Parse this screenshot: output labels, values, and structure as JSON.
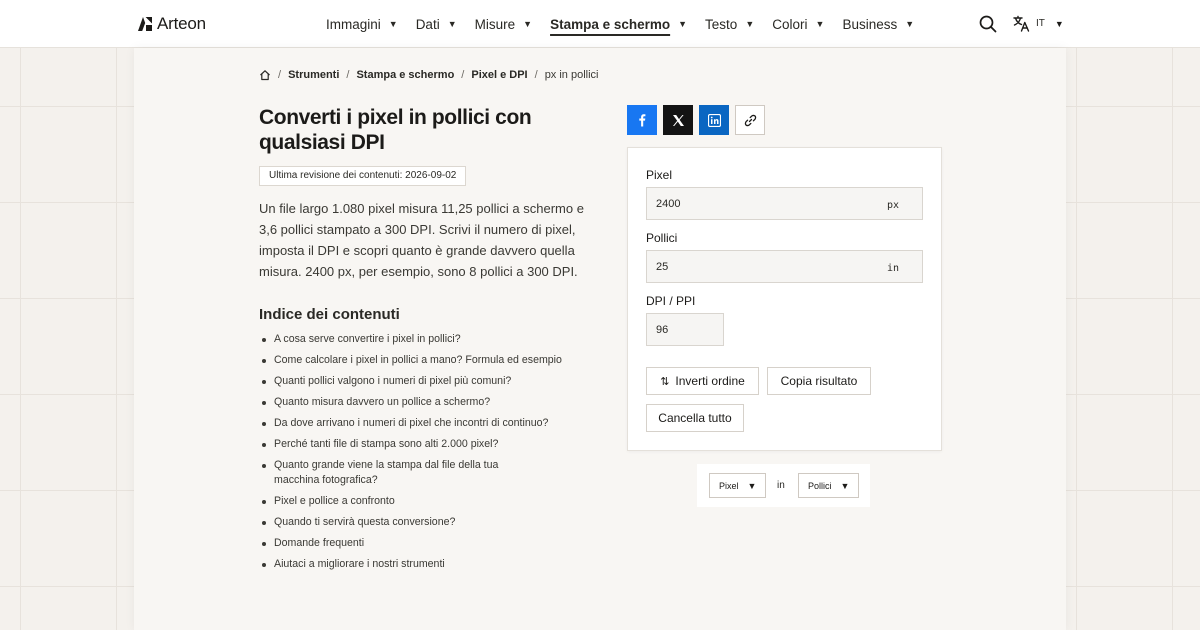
{
  "brand": {
    "name": "Arteon"
  },
  "nav": {
    "items": [
      {
        "label": "Immagini",
        "active": false
      },
      {
        "label": "Dati",
        "active": false
      },
      {
        "label": "Misure",
        "active": false
      },
      {
        "label": "Stampa e schermo",
        "active": true
      },
      {
        "label": "Testo",
        "active": false
      },
      {
        "label": "Colori",
        "active": false
      },
      {
        "label": "Business",
        "active": false
      }
    ],
    "caret": "▼",
    "language": "IT"
  },
  "breadcrumb": {
    "items": [
      "Strumenti",
      "Stampa e schermo",
      "Pixel e DPI"
    ],
    "current": "px in pollici",
    "separator": "/"
  },
  "page": {
    "title": "Converti i pixel in pollici con qualsiasi DPI",
    "revision": "Ultima revisione dei contenuti: 2026-09-02",
    "intro": "Un file largo 1.080 pixel misura 11,25 pollici a schermo e 3,6 pollici stampato a 300 DPI. Scrivi il numero di pixel, imposta il DPI e scopri quanto è grande davvero quella misura. 2400 px, per esempio, sono 8 pollici a 300 DPI."
  },
  "toc": {
    "title": "Indice dei contenuti",
    "items": [
      "A cosa serve convertire i pixel in pollici?",
      "Come calcolare i pixel in pollici a mano? Formula ed esempio",
      "Quanti pollici valgono i numeri di pixel più comuni?",
      "Quanto misura davvero un pollice a schermo?",
      "Da dove arrivano i numeri di pixel che incontri di continuo?",
      "Perché tanti file di stampa sono alti 2.000 pixel?",
      "Quanto grande viene la stampa dal file della tua macchina fotografica?",
      "Pixel e pollice a confronto",
      "Quando ti servirà questa conversione?",
      "Domande frequenti",
      "Aiutaci a migliorare i nostri strumenti"
    ]
  },
  "share": {
    "icons": [
      "facebook-icon",
      "x-icon",
      "linkedin-icon",
      "link-icon"
    ],
    "colors": {
      "facebook": "#1877f2",
      "x": "#141414",
      "linkedin": "#0a66c2"
    }
  },
  "converter": {
    "pixel": {
      "label": "Pixel",
      "value": "2400",
      "unit": "px"
    },
    "inches": {
      "label": "Pollici",
      "value": "25",
      "unit": "in"
    },
    "dpi": {
      "label": "DPI / PPI",
      "value": "96"
    },
    "buttons": {
      "swap": "Inverti ordine",
      "copy": "Copia risultato",
      "clear": "Cancella tutto"
    }
  },
  "unit_selector": {
    "from": "Pixel",
    "connector": "in",
    "to": "Pollici"
  }
}
